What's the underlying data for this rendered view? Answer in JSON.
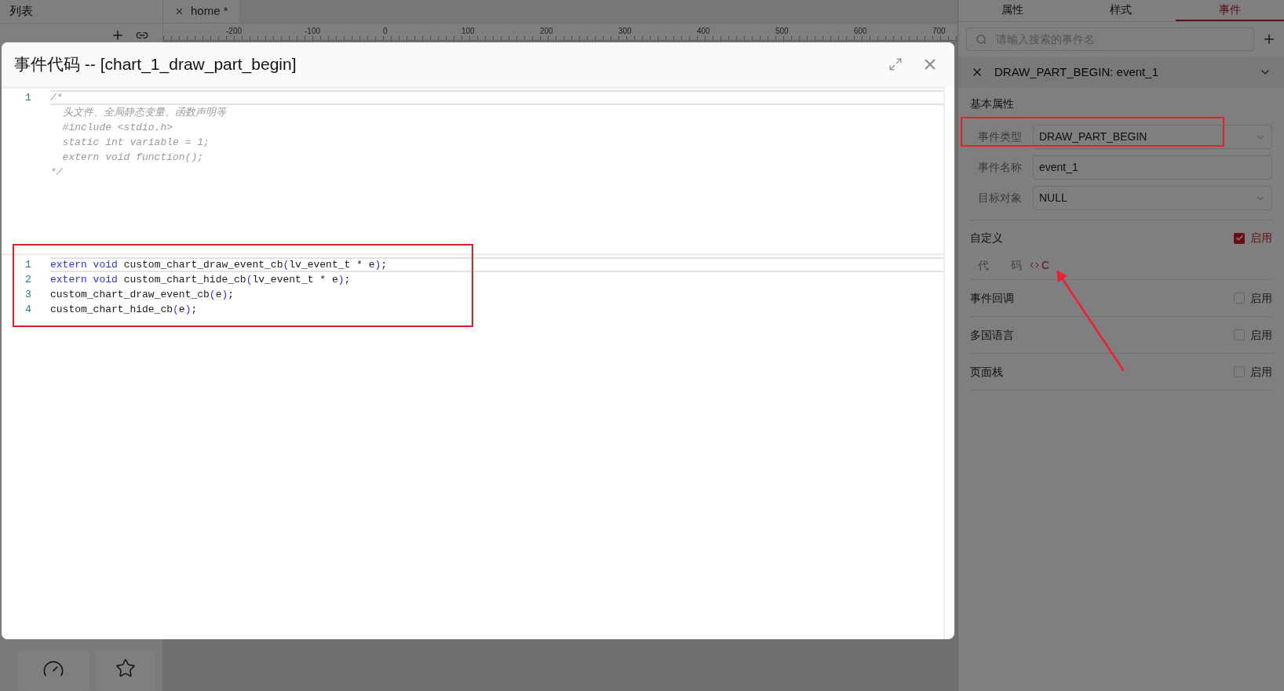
{
  "left_panel": {
    "title": "列表"
  },
  "editor_tabs": [
    {
      "label": "home *",
      "selected": true
    }
  ],
  "ruler": {
    "labels": [
      "-200",
      "-100",
      "0",
      "100",
      "200",
      "300",
      "400",
      "500",
      "600",
      "700"
    ]
  },
  "dialog": {
    "title": "事件代码 -- [chart_1_draw_part_begin]",
    "editors": [
      {
        "lines": [
          {
            "number": "1",
            "current": true,
            "tokens": [
              {
                "kind": "comment",
                "text": "/*"
              }
            ]
          },
          {
            "current": false,
            "tokens": [
              {
                "kind": "comment",
                "text": "  头文件、全局静态变量、函数声明等"
              }
            ]
          },
          {
            "current": false,
            "tokens": [
              {
                "kind": "comment",
                "text": "  #include <stdio.h>"
              }
            ]
          },
          {
            "current": false,
            "tokens": [
              {
                "kind": "comment",
                "text": "  static int variable = 1;"
              }
            ]
          },
          {
            "current": false,
            "tokens": [
              {
                "kind": "comment",
                "text": "  extern void function();"
              }
            ]
          },
          {
            "current": false,
            "tokens": [
              {
                "kind": "comment",
                "text": "*/"
              }
            ]
          }
        ]
      },
      {
        "lines": [
          {
            "number": "1",
            "current": true,
            "tokens": [
              {
                "kind": "keyword",
                "text": "extern void"
              },
              {
                "kind": "plain",
                "text": " custom_chart_draw_event_cb"
              },
              {
                "kind": "paren",
                "text": "("
              },
              {
                "kind": "plain",
                "text": "lv_event_t * e"
              },
              {
                "kind": "paren",
                "text": ")"
              },
              {
                "kind": "plain",
                "text": ";"
              }
            ]
          },
          {
            "number": "2",
            "current": false,
            "tokens": [
              {
                "kind": "keyword",
                "text": "extern void"
              },
              {
                "kind": "plain",
                "text": " custom_chart_hide_cb"
              },
              {
                "kind": "paren",
                "text": "("
              },
              {
                "kind": "plain",
                "text": "lv_event_t * e"
              },
              {
                "kind": "paren",
                "text": ")"
              },
              {
                "kind": "plain",
                "text": ";"
              }
            ]
          },
          {
            "number": "3",
            "current": false,
            "tokens": [
              {
                "kind": "plain",
                "text": "custom_chart_draw_event_cb"
              },
              {
                "kind": "paren",
                "text": "("
              },
              {
                "kind": "plain",
                "text": "e"
              },
              {
                "kind": "paren",
                "text": ")"
              },
              {
                "kind": "plain",
                "text": ";"
              }
            ]
          },
          {
            "number": "4",
            "current": false,
            "tokens": [
              {
                "kind": "plain",
                "text": "custom_chart_hide_cb"
              },
              {
                "kind": "paren",
                "text": "("
              },
              {
                "kind": "plain",
                "text": "e"
              },
              {
                "kind": "paren",
                "text": ")"
              },
              {
                "kind": "plain",
                "text": ";"
              }
            ]
          }
        ]
      }
    ]
  },
  "right_panel": {
    "tabs": [
      {
        "label": "属性",
        "selected": false
      },
      {
        "label": "样式",
        "selected": false
      },
      {
        "label": "事件",
        "selected": true
      }
    ],
    "search": {
      "placeholder": "请输入搜索的事件名"
    },
    "event": {
      "title": "DRAW_PART_BEGIN: event_1",
      "expanded": true
    },
    "section_title": "基本属性",
    "fields": [
      {
        "label": "事件类型",
        "kind": "select",
        "value": "DRAW_PART_BEGIN"
      },
      {
        "label": "事件名称",
        "kind": "input",
        "value": "event_1"
      },
      {
        "label": "目标对象",
        "kind": "select",
        "value": "NULL"
      }
    ],
    "custom": {
      "label": "自定义",
      "checkbox_label": "启用",
      "checked": true,
      "code_label": "代 码",
      "code_link": "C"
    },
    "options": [
      {
        "label": "事件回调",
        "checkbox_label": "启用",
        "checked": false
      },
      {
        "label": "多国语言",
        "checkbox_label": "启用",
        "checked": false
      },
      {
        "label": "页面栈",
        "checkbox_label": "启用",
        "checked": false
      }
    ]
  }
}
